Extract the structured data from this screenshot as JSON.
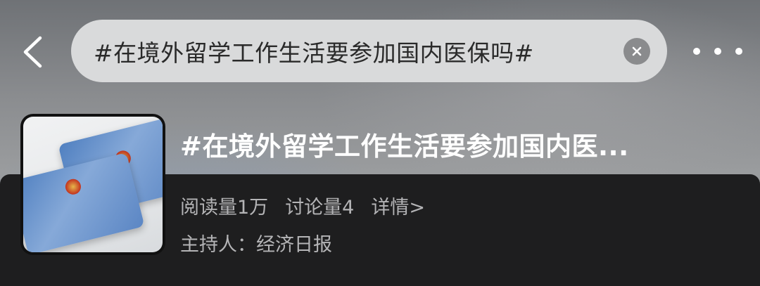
{
  "header": {
    "search_query": "#在境外留学工作生活要参加国内医保吗#",
    "back_icon": "chevron-left-icon",
    "clear_icon": "close-icon",
    "more_icon": "more-horizontal-icon"
  },
  "topic": {
    "title": "#在境外留学工作生活要参加国内医...",
    "read_count": "阅读量1万",
    "discussion_count": "讨论量4",
    "details_link": "详情>",
    "host": "主持人：经济日报"
  },
  "colors": {
    "search_bg": "#d9dadb",
    "dark_band": "#1e1e1f",
    "secondary_text": "#b4b4b6"
  }
}
